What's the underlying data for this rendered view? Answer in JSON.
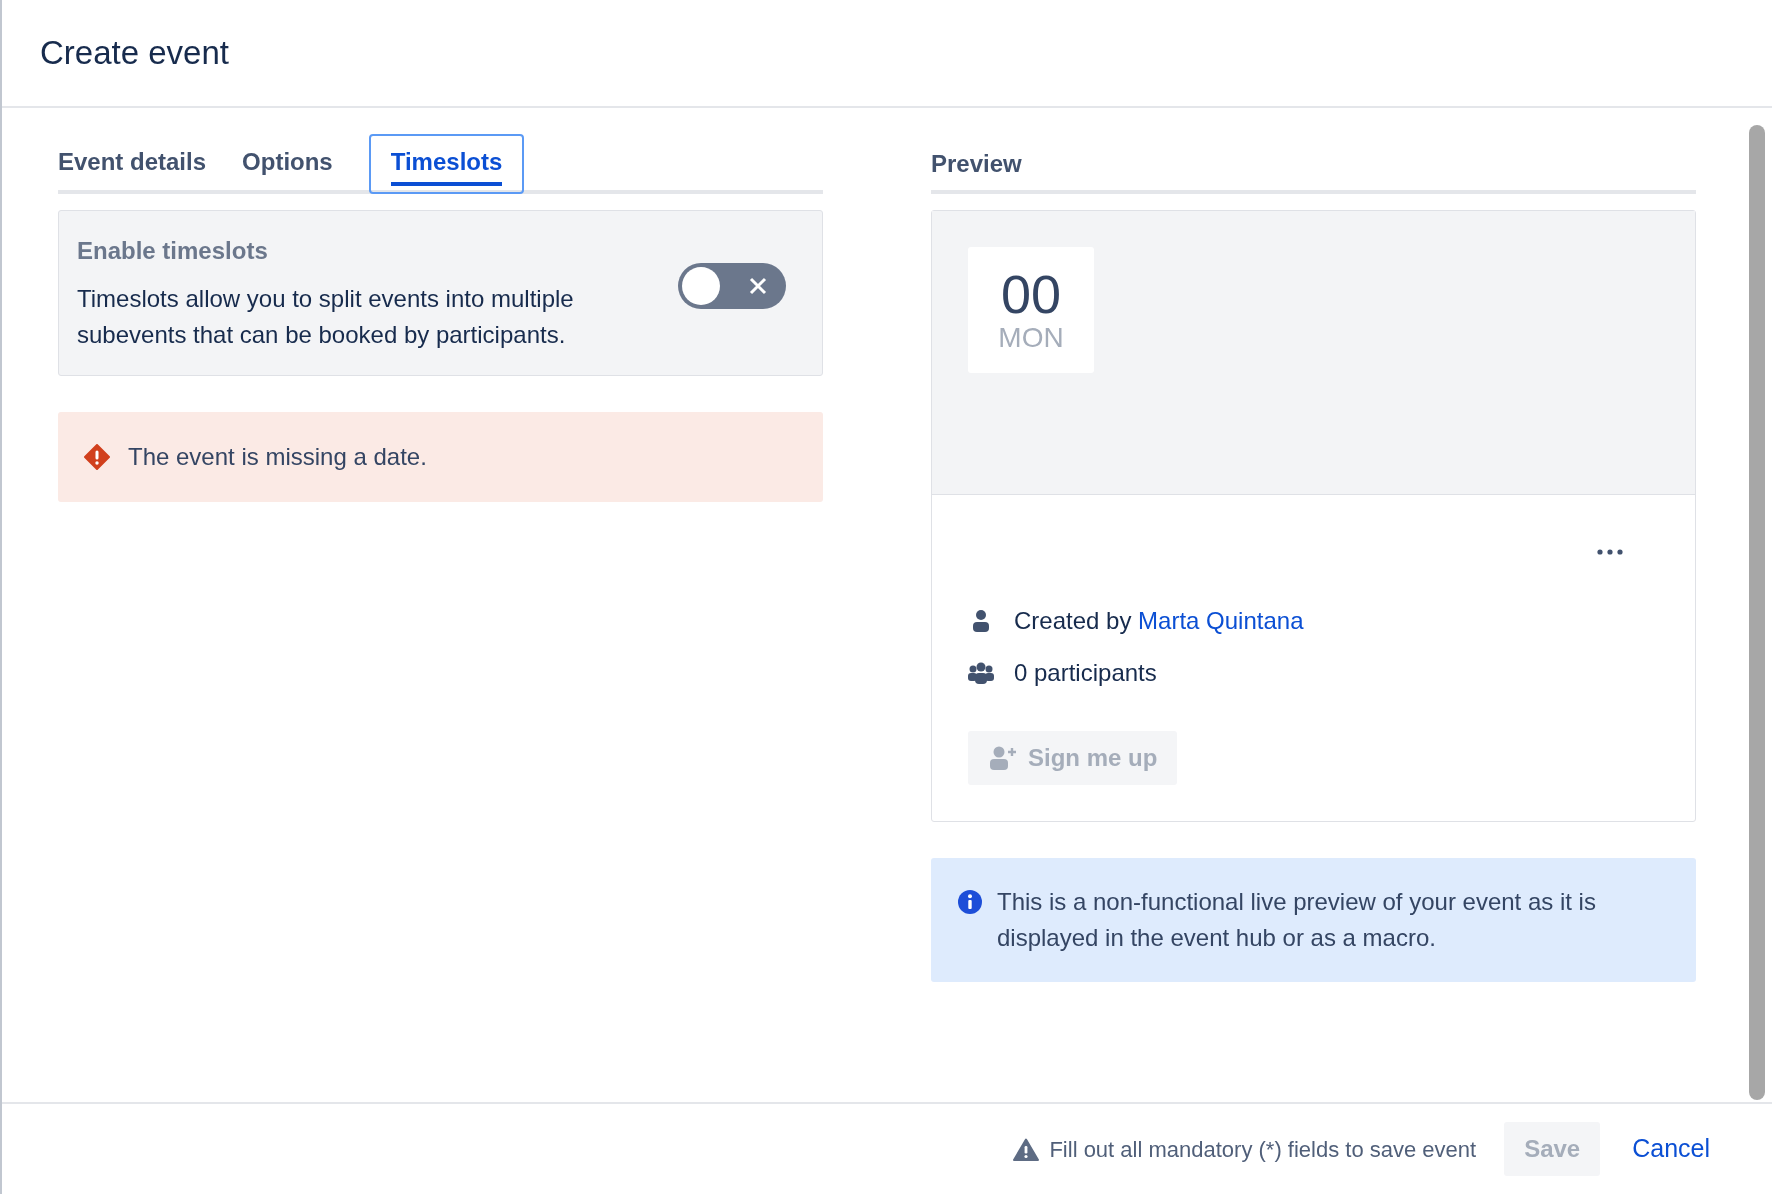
{
  "dialog": {
    "title": "Create event"
  },
  "tabs": [
    {
      "label": "Event details",
      "selected": false
    },
    {
      "label": "Options",
      "selected": false
    },
    {
      "label": "Timeslots",
      "selected": true
    }
  ],
  "timeslots_panel": {
    "heading": "Enable timeslots",
    "description": "Timeslots allow you to split events into multiple subevents that can be booked by participants.",
    "on": false
  },
  "error_message": "The event is missing a date.",
  "preview": {
    "heading": "Preview",
    "day": "00",
    "weekday": "MON",
    "created_by_label": "Created by",
    "creator": "Marta Quintana",
    "participants": "0 participants",
    "signup_button": {
      "label": "Sign me up",
      "disabled": true
    }
  },
  "info_message": "This is a non-functional live preview of your event as it is displayed in the event hub or as a macro.",
  "footer": {
    "warning": "Fill out all mandatory (*) fields to save event",
    "save_button": {
      "label": "Save",
      "disabled": true
    },
    "cancel_button": "Cancel"
  }
}
